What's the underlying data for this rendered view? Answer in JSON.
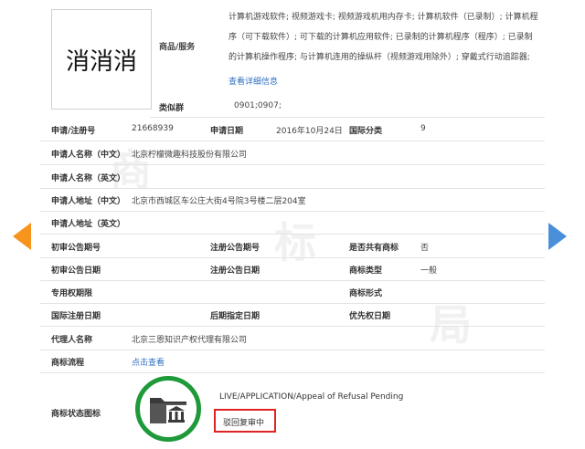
{
  "trademark": {
    "image_text": "消消消",
    "goods_label": "商品/服务",
    "goods_lines": [
      "计算机游戏软件; 视频游戏卡; 视频游戏机用内存卡; 计算机软件（已录制）; 计算机程",
      "序（可下载软件）; 可下载的计算机应用软件; 已录制的计算机程序（程序）; 已录制",
      "的计算机操作程序; 与计算机连用的操纵杆（视频游戏用除外）; 穿戴式行动追踪器;"
    ],
    "more_link": "查看详细信息",
    "class_label": "类似群",
    "class_value": "0901;0907;"
  },
  "rows": {
    "app_no_label": "申请/注册号",
    "app_no_value": "21668939",
    "app_date_label": "申请日期",
    "app_date_value": "2016年10月24日",
    "intl_class_label": "国际分类",
    "intl_class_value": "9",
    "applicant_cn_label": "申请人名称（中文）",
    "applicant_cn_value": "北京柠檬微趣科技股份有限公司",
    "applicant_en_label": "申请人名称（英文）",
    "address_cn_label": "申请人地址（中文）",
    "address_cn_value": "北京市西城区车公庄大街4号院3号楼二层204室",
    "address_en_label": "申请人地址（英文）",
    "prelim_no_label": "初审公告期号",
    "reg_no_label": "注册公告期号",
    "shared_label": "是否共有商标",
    "shared_value": "否",
    "prelim_date_label": "初审公告日期",
    "reg_date_label": "注册公告日期",
    "type_label": "商标类型",
    "type_value": "一般",
    "exclusive_label": "专用权期限",
    "form_label": "商标形式",
    "intl_reg_label": "国际注册日期",
    "later_label": "后期指定日期",
    "priority_label": "优先权日期",
    "agent_label": "代理人名称",
    "agent_value": "北京三恩知识产权代理有限公司",
    "process_label": "商标流程",
    "process_link": "点击查看"
  },
  "status": {
    "label": "商标状态图标",
    "english": "LIVE/APPLICATION/Appeal of Refusal Pending",
    "chinese": "驳回复审中",
    "accent": "#1e9a3a",
    "highlight": "#e02222"
  },
  "nav": {
    "left_icon": "arrow-left-icon",
    "right_icon": "arrow-right-icon",
    "left_color": "#f7941d",
    "right_color": "#4a90d9"
  }
}
